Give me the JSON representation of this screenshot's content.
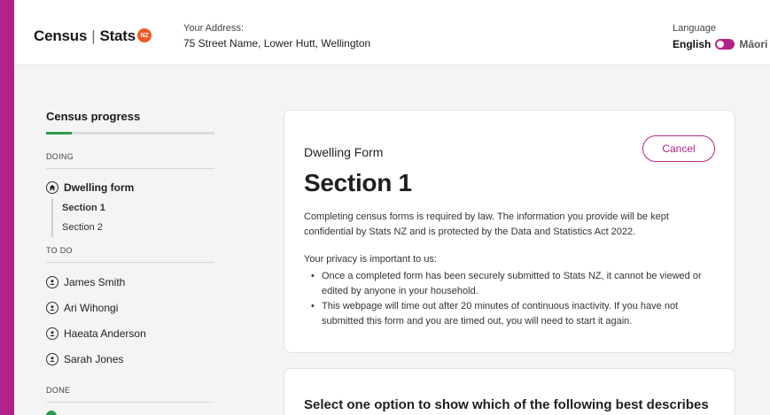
{
  "header": {
    "logo_census": "Census",
    "logo_sep": "|",
    "logo_stats": "Stats",
    "logo_badge": "NZ",
    "address_label": "Your Address:",
    "address_value": "75 Street Name, Lower Hutt, Wellington",
    "language_label": "Language",
    "language_english": "English",
    "language_maori": "Māori"
  },
  "sidebar": {
    "title": "Census progress",
    "progress_fraction": 0.15,
    "doing_label": "DOING",
    "dwelling_form": "Dwelling form",
    "sections": [
      "Section 1",
      "Section 2"
    ],
    "todo_label": "TO DO",
    "people": [
      "James Smith",
      "Ari Wihongi",
      "Haeata Anderson",
      "Sarah Jones"
    ],
    "done_label": "DONE"
  },
  "card": {
    "form_name": "Dwelling Form",
    "cancel_label": "Cancel",
    "section_title": "Section 1",
    "intro": "Completing census forms is required by law. The information you provide will be kept confidential by Stats NZ and is protected by the Data and Statistics Act 2022.",
    "privacy_heading": "Your privacy is important to us:",
    "privacy_points": [
      "Once a completed form has been securely submitted to Stats NZ, it cannot be viewed or edited by anyone in your household.",
      "This webpage will time out after 20 minutes of continuous inactivity. If you have not submitted this form and you are timed out, you will need to start it again."
    ]
  },
  "question": {
    "title": "Select one option to show which of the following best describes"
  },
  "colors": {
    "brand": "#b3228a",
    "progress": "#2e9a4a",
    "badge": "#f05a28"
  }
}
